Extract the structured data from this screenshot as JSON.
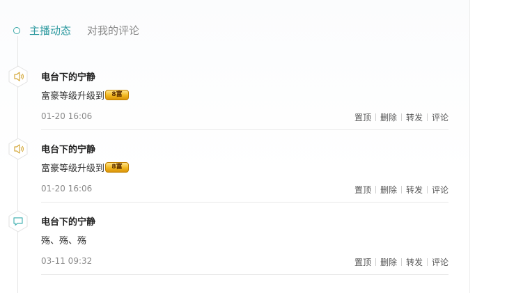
{
  "tabs": [
    {
      "label": "主播动态",
      "active": true
    },
    {
      "label": "对我的评论",
      "active": false
    }
  ],
  "feed": [
    {
      "icon": "speaker-icon",
      "author": "电台下的宁静",
      "content_text": "富豪等级升级到",
      "badge": "8富",
      "time": "01-20 16:06",
      "actions": [
        "置顶",
        "删除",
        "转发",
        "评论"
      ]
    },
    {
      "icon": "speaker-icon",
      "author": "电台下的宁静",
      "content_text": "富豪等级升级到",
      "badge": "8富",
      "time": "01-20 16:06",
      "actions": [
        "置顶",
        "删除",
        "转发",
        "评论"
      ]
    },
    {
      "icon": "comment-icon",
      "author": "电台下的宁静",
      "content_text": "殇、殇、殇",
      "badge": "",
      "time": "03-11 09:32",
      "actions": [
        "置顶",
        "删除",
        "转发",
        "评论"
      ]
    }
  ],
  "colors": {
    "accent": "#2f9aa0",
    "icon_gold": "#d4a83a",
    "icon_teal": "#49b3b5"
  }
}
